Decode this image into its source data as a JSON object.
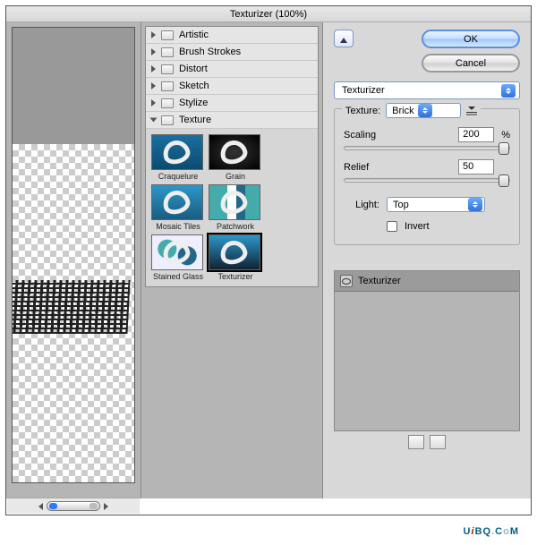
{
  "window": {
    "title": "Texturizer (100%)"
  },
  "folders": [
    {
      "label": "Artistic",
      "open": false
    },
    {
      "label": "Brush Strokes",
      "open": false
    },
    {
      "label": "Distort",
      "open": false
    },
    {
      "label": "Sketch",
      "open": false
    },
    {
      "label": "Stylize",
      "open": false
    },
    {
      "label": "Texture",
      "open": true
    }
  ],
  "thumbs": [
    {
      "label": "Craquelure",
      "cls": "craq"
    },
    {
      "label": "Grain",
      "cls": "grain"
    },
    {
      "label": "Mosaic Tiles",
      "cls": "mosaic"
    },
    {
      "label": "Patchwork",
      "cls": "patch"
    },
    {
      "label": "Stained Glass",
      "cls": "glass"
    },
    {
      "label": "Texturizer",
      "cls": "texz",
      "selected": true
    }
  ],
  "buttons": {
    "ok": "OK",
    "cancel": "Cancel"
  },
  "filter_select": "Texturizer",
  "texture_group": {
    "label": "Texture:",
    "value": "Brick",
    "scaling_label": "Scaling",
    "scaling_value": "200",
    "scaling_unit": "%",
    "relief_label": "Relief",
    "relief_value": "50",
    "light_label": "Light:",
    "light_value": "Top",
    "invert_label": "Invert"
  },
  "history": {
    "item": "Texturizer"
  },
  "watermark": "UiBQ.CoM"
}
